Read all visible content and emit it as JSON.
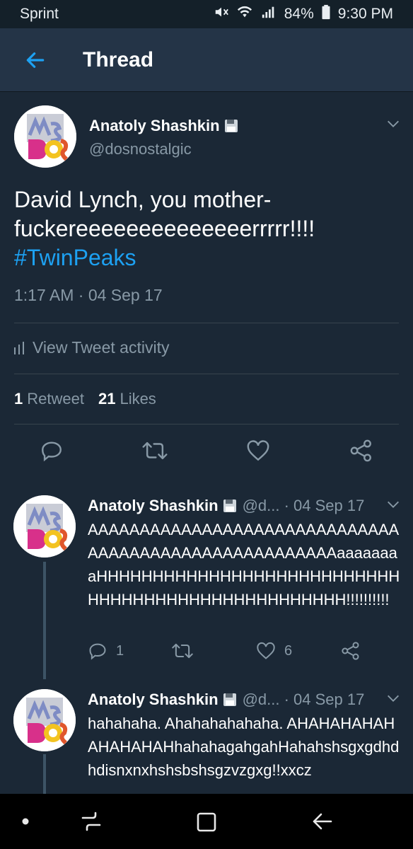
{
  "status": {
    "carrier": "Sprint",
    "battery": "84%",
    "time": "9:30 PM"
  },
  "appbar": {
    "title": "Thread"
  },
  "tweet": {
    "name": "Anatoly Shashkin",
    "handle": "@dosnostalgic",
    "text_line1": "David Lynch, you mother-",
    "text_line2": "fuckereeeeeeeeeeeeeerrrrr!!!!",
    "hashtag": "#TwinPeaks",
    "timestamp": "1:17 AM · 04 Sep 17",
    "activity_label": "View Tweet activity",
    "retweets_count": "1",
    "retweets_label": "Retweet",
    "likes_count": "21",
    "likes_label": "Likes"
  },
  "replies": [
    {
      "name": "Anatoly Shashkin",
      "meta": "@d... · 04 Sep 17",
      "text": "AAAAAAAAAAAAAAAAAAAAAAAAAAAAAAAAAAAAAAAAAAAAAAAAAAAAAAaaaaaaaaHHHHHHHHHHHHHHHHHHHHHHHHHHHHHHHHHHHHHHHHHHHHHHHHHH!!!!!!!!!!",
      "reply_count": "1",
      "like_count": "6"
    },
    {
      "name": "Anatoly Shashkin",
      "meta": "@d... · 04 Sep 17",
      "text": "hahahaha. Ahahahahahaha. AHAHAHAHAHAHAHAHAHhahahagahgahHahahshsgxgdhdhdisnxnxhshsbshsgzvzgxg!!xxcz"
    }
  ]
}
